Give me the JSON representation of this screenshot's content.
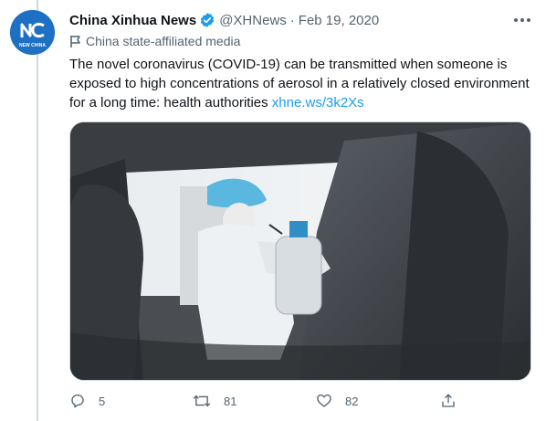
{
  "account": {
    "display_name": "China Xinhua News",
    "handle": "@XHNews",
    "separator": "·",
    "date": "Feb 19, 2020",
    "avatar_caption": "NEW CHINA",
    "affiliation": "China state-affiliated media"
  },
  "tweet": {
    "text": "The novel coronavirus (COVID-19) can be transmitted when someone is exposed to high concentrations of aerosol in a relatively closed environment for a long time: health authorities ",
    "link": "xhne.ws/3k2Xs"
  },
  "actions": {
    "reply_count": "5",
    "retweet_count": "81",
    "like_count": "82"
  },
  "icons": {
    "verified": "verified-badge-icon",
    "more": "more-dots-icon",
    "affiliation": "flag-icon",
    "reply": "reply-icon",
    "retweet": "retweet-icon",
    "like": "heart-icon",
    "share": "share-icon"
  },
  "colors": {
    "text": "#0f1419",
    "secondary": "#536471",
    "link": "#1d9bf0",
    "avatar": "#1d70c4"
  }
}
